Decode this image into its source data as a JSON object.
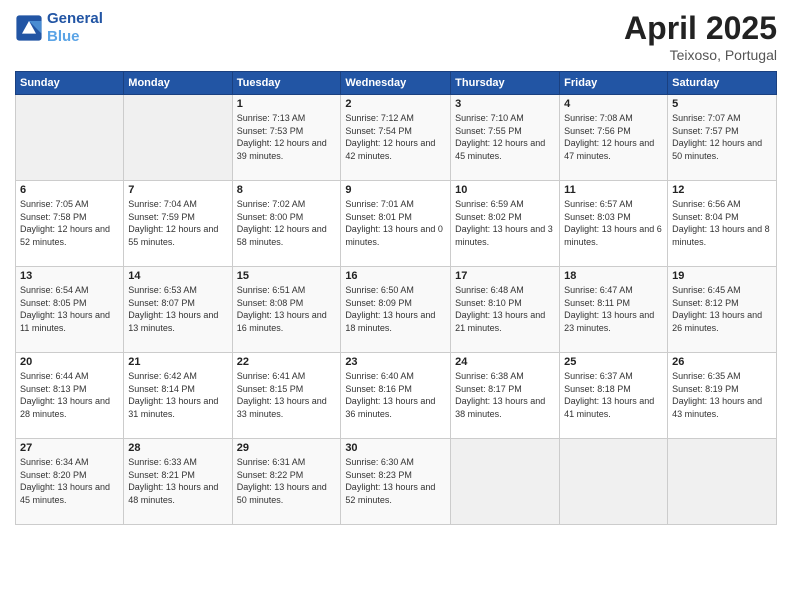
{
  "header": {
    "logo_line1": "General",
    "logo_line2": "Blue",
    "month": "April 2025",
    "location": "Teixoso, Portugal"
  },
  "days_of_week": [
    "Sunday",
    "Monday",
    "Tuesday",
    "Wednesday",
    "Thursday",
    "Friday",
    "Saturday"
  ],
  "weeks": [
    [
      {
        "day": "",
        "info": ""
      },
      {
        "day": "",
        "info": ""
      },
      {
        "day": "1",
        "info": "Sunrise: 7:13 AM\nSunset: 7:53 PM\nDaylight: 12 hours and 39 minutes."
      },
      {
        "day": "2",
        "info": "Sunrise: 7:12 AM\nSunset: 7:54 PM\nDaylight: 12 hours and 42 minutes."
      },
      {
        "day": "3",
        "info": "Sunrise: 7:10 AM\nSunset: 7:55 PM\nDaylight: 12 hours and 45 minutes."
      },
      {
        "day": "4",
        "info": "Sunrise: 7:08 AM\nSunset: 7:56 PM\nDaylight: 12 hours and 47 minutes."
      },
      {
        "day": "5",
        "info": "Sunrise: 7:07 AM\nSunset: 7:57 PM\nDaylight: 12 hours and 50 minutes."
      }
    ],
    [
      {
        "day": "6",
        "info": "Sunrise: 7:05 AM\nSunset: 7:58 PM\nDaylight: 12 hours and 52 minutes."
      },
      {
        "day": "7",
        "info": "Sunrise: 7:04 AM\nSunset: 7:59 PM\nDaylight: 12 hours and 55 minutes."
      },
      {
        "day": "8",
        "info": "Sunrise: 7:02 AM\nSunset: 8:00 PM\nDaylight: 12 hours and 58 minutes."
      },
      {
        "day": "9",
        "info": "Sunrise: 7:01 AM\nSunset: 8:01 PM\nDaylight: 13 hours and 0 minutes."
      },
      {
        "day": "10",
        "info": "Sunrise: 6:59 AM\nSunset: 8:02 PM\nDaylight: 13 hours and 3 minutes."
      },
      {
        "day": "11",
        "info": "Sunrise: 6:57 AM\nSunset: 8:03 PM\nDaylight: 13 hours and 6 minutes."
      },
      {
        "day": "12",
        "info": "Sunrise: 6:56 AM\nSunset: 8:04 PM\nDaylight: 13 hours and 8 minutes."
      }
    ],
    [
      {
        "day": "13",
        "info": "Sunrise: 6:54 AM\nSunset: 8:05 PM\nDaylight: 13 hours and 11 minutes."
      },
      {
        "day": "14",
        "info": "Sunrise: 6:53 AM\nSunset: 8:07 PM\nDaylight: 13 hours and 13 minutes."
      },
      {
        "day": "15",
        "info": "Sunrise: 6:51 AM\nSunset: 8:08 PM\nDaylight: 13 hours and 16 minutes."
      },
      {
        "day": "16",
        "info": "Sunrise: 6:50 AM\nSunset: 8:09 PM\nDaylight: 13 hours and 18 minutes."
      },
      {
        "day": "17",
        "info": "Sunrise: 6:48 AM\nSunset: 8:10 PM\nDaylight: 13 hours and 21 minutes."
      },
      {
        "day": "18",
        "info": "Sunrise: 6:47 AM\nSunset: 8:11 PM\nDaylight: 13 hours and 23 minutes."
      },
      {
        "day": "19",
        "info": "Sunrise: 6:45 AM\nSunset: 8:12 PM\nDaylight: 13 hours and 26 minutes."
      }
    ],
    [
      {
        "day": "20",
        "info": "Sunrise: 6:44 AM\nSunset: 8:13 PM\nDaylight: 13 hours and 28 minutes."
      },
      {
        "day": "21",
        "info": "Sunrise: 6:42 AM\nSunset: 8:14 PM\nDaylight: 13 hours and 31 minutes."
      },
      {
        "day": "22",
        "info": "Sunrise: 6:41 AM\nSunset: 8:15 PM\nDaylight: 13 hours and 33 minutes."
      },
      {
        "day": "23",
        "info": "Sunrise: 6:40 AM\nSunset: 8:16 PM\nDaylight: 13 hours and 36 minutes."
      },
      {
        "day": "24",
        "info": "Sunrise: 6:38 AM\nSunset: 8:17 PM\nDaylight: 13 hours and 38 minutes."
      },
      {
        "day": "25",
        "info": "Sunrise: 6:37 AM\nSunset: 8:18 PM\nDaylight: 13 hours and 41 minutes."
      },
      {
        "day": "26",
        "info": "Sunrise: 6:35 AM\nSunset: 8:19 PM\nDaylight: 13 hours and 43 minutes."
      }
    ],
    [
      {
        "day": "27",
        "info": "Sunrise: 6:34 AM\nSunset: 8:20 PM\nDaylight: 13 hours and 45 minutes."
      },
      {
        "day": "28",
        "info": "Sunrise: 6:33 AM\nSunset: 8:21 PM\nDaylight: 13 hours and 48 minutes."
      },
      {
        "day": "29",
        "info": "Sunrise: 6:31 AM\nSunset: 8:22 PM\nDaylight: 13 hours and 50 minutes."
      },
      {
        "day": "30",
        "info": "Sunrise: 6:30 AM\nSunset: 8:23 PM\nDaylight: 13 hours and 52 minutes."
      },
      {
        "day": "",
        "info": ""
      },
      {
        "day": "",
        "info": ""
      },
      {
        "day": "",
        "info": ""
      }
    ]
  ]
}
